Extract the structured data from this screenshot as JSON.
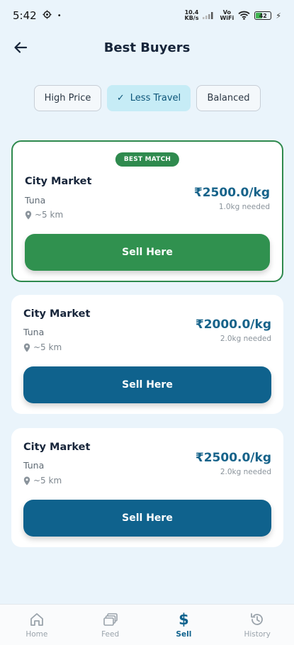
{
  "status": {
    "time": "5:42",
    "net_speed": "10.4",
    "net_unit": "KB/s",
    "vo": "Vo",
    "wifi": "WiFi",
    "battery": "42"
  },
  "header": {
    "title": "Best Buyers"
  },
  "filters": [
    {
      "label": "High Price",
      "active": false
    },
    {
      "label": "Less Travel",
      "active": true
    },
    {
      "label": "Balanced",
      "active": false
    }
  ],
  "buyers": [
    {
      "badge": "BEST MATCH",
      "name": "City Market",
      "fish": "Tuna",
      "distance": "~5 km",
      "price": "₹2500.0/kg",
      "needed": "1.0kg needed",
      "button": "Sell Here"
    },
    {
      "name": "City Market",
      "fish": "Tuna",
      "distance": "~5 km",
      "price": "₹2000.0/kg",
      "needed": "2.0kg needed",
      "button": "Sell Here"
    },
    {
      "name": "City Market",
      "fish": "Tuna",
      "distance": "~5 km",
      "price": "₹2500.0/kg",
      "needed": "2.0kg needed",
      "button": "Sell Here"
    }
  ],
  "nav": [
    {
      "label": "Home",
      "icon": "home-icon"
    },
    {
      "label": "Feed",
      "icon": "feed-icon"
    },
    {
      "label": "Sell",
      "icon": "dollar-icon",
      "active": true
    },
    {
      "label": "History",
      "icon": "history-icon"
    }
  ],
  "colors": {
    "accent": "#0f628d",
    "success": "#30914f",
    "background": "#eaf4fb",
    "chip_active": "#c6ecf6"
  }
}
